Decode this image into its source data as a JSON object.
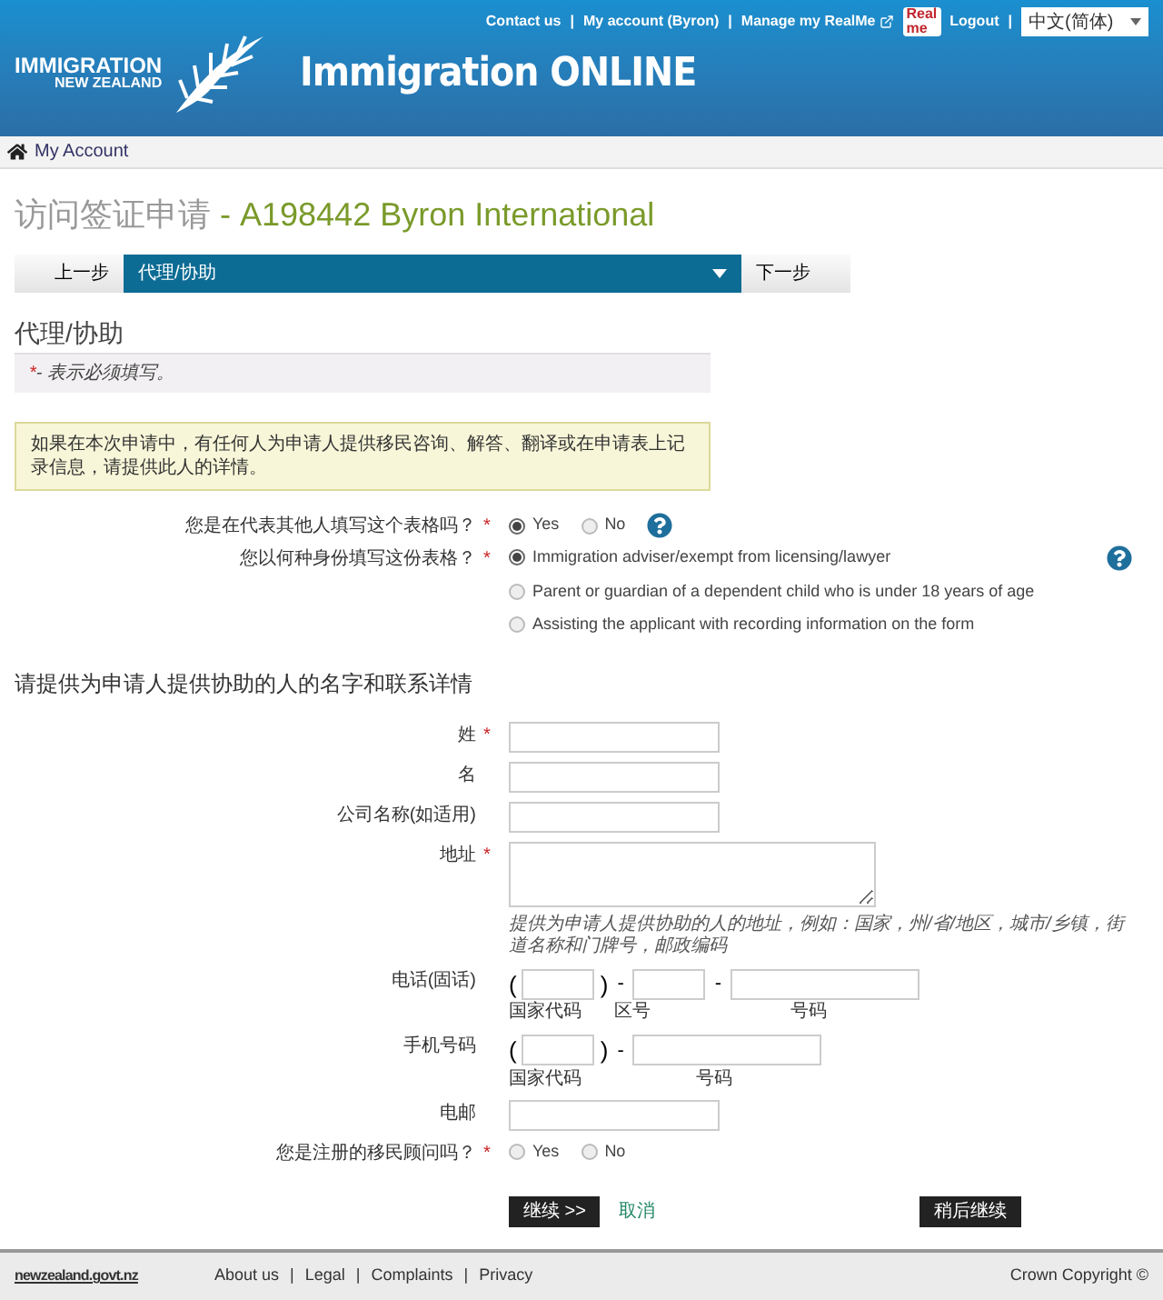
{
  "header": {
    "logo": {
      "line1": "IMMIGRATION",
      "line2": "NEW ZEALAND"
    },
    "site_title": "Immigration ONLINE",
    "nav": [
      {
        "label": "Contact us",
        "kind": "link"
      },
      {
        "label": "My account (Byron)",
        "kind": "link"
      },
      {
        "label": "Manage my RealMe",
        "kind": "external"
      },
      {
        "kind": "badge",
        "lines": [
          "Real",
          "me"
        ]
      },
      {
        "label": "Logout",
        "kind": "link"
      }
    ],
    "separator": "|",
    "language": "中文(简体)"
  },
  "breadcrumb": "My Account",
  "page_title": {
    "prefix": "访问签证申请",
    "rest": "- A198442 Byron International"
  },
  "step_nav": {
    "prev": "上一步",
    "current": "代理/协助",
    "next": "下一步"
  },
  "section_title": "代理/协助",
  "required_note": {
    "mark": "*",
    "text": "- 表示必须填写。"
  },
  "info_box": "如果在本次申请中，有任何人为申请人提供移民咨询、解答、翻译或在申请表上记录信息，请提供此人的详情。",
  "questions": [
    {
      "label": "您是在代表其他人填写这个表格吗？",
      "required": true,
      "kind": "inline",
      "help": true,
      "options": [
        {
          "label": "Yes",
          "selected": true
        },
        {
          "label": "No",
          "selected": false
        }
      ]
    },
    {
      "label": "您以何种身份填写这份表格？",
      "required": true,
      "kind": "stacked",
      "help": true,
      "options": [
        {
          "label": "Immigration adviser/exempt from licensing/lawyer",
          "selected": true
        },
        {
          "label": "Parent or guardian of a dependent child who is under 18 years of age",
          "selected": false
        },
        {
          "label": "Assisting the applicant with recording information on the form",
          "selected": false
        }
      ]
    }
  ],
  "contact_heading": "请提供为申请人提供协助的人的名字和联系详情",
  "fields": [
    {
      "kind": "text",
      "label": "姓",
      "required": true
    },
    {
      "kind": "text",
      "label": "名",
      "required": false
    },
    {
      "kind": "text",
      "label": "公司名称(如适用)",
      "required": false
    },
    {
      "kind": "textarea",
      "label": "地址",
      "required": true,
      "hint": "提供为申请人提供协助的人的地址，例如：国家，州/省/地区，城市/乡镇，街道名称和门牌号，邮政编码"
    },
    {
      "kind": "phone",
      "label": "电话(固话)",
      "required": false,
      "open": "(",
      "close": ")",
      "separator": "-",
      "parts": [
        {
          "kind": "country",
          "sublabel": "国家代码"
        },
        {
          "kind": "area",
          "sublabel": "区号"
        },
        {
          "kind": "number",
          "sublabel": "号码"
        }
      ]
    },
    {
      "kind": "phone",
      "label": "手机号码",
      "required": false,
      "open": "(",
      "close": ")",
      "separator": "-",
      "parts": [
        {
          "kind": "country",
          "sublabel": "国家代码"
        },
        {
          "kind": "wide",
          "sublabel": "号码"
        }
      ]
    },
    {
      "kind": "text",
      "label": "电邮",
      "required": false
    },
    {
      "kind": "radio",
      "label": "您是注册的移民顾问吗？",
      "required": true,
      "options": [
        {
          "label": "Yes",
          "selected": false
        },
        {
          "label": "No",
          "selected": false
        }
      ]
    }
  ],
  "buttons": {
    "continue": "继续 >>",
    "cancel": "取消",
    "save": "稍后继续"
  },
  "footer": {
    "brand": "newzealand.govt.nz",
    "links": [
      "About us",
      "Legal",
      "Complaints",
      "Privacy"
    ],
    "separator": "|",
    "copyright": "Crown Copyright ©"
  }
}
